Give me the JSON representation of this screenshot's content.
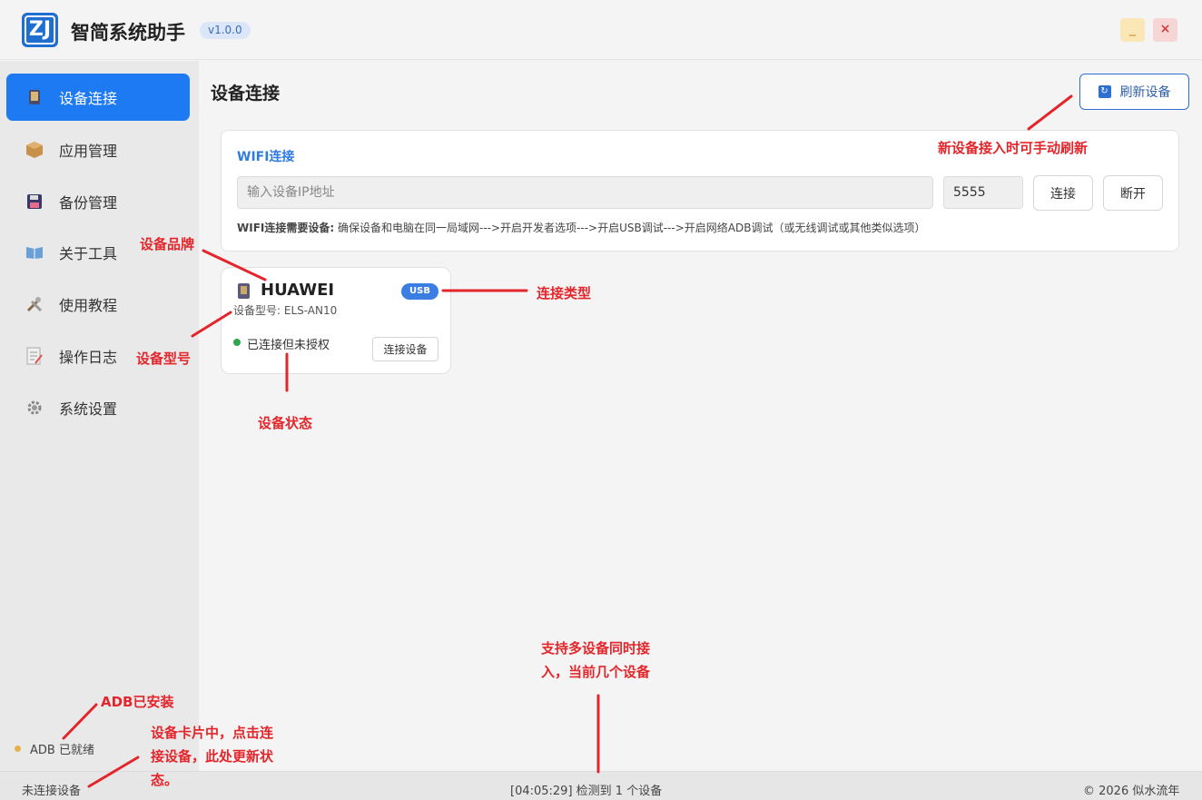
{
  "app": {
    "title": "智简系统助手",
    "version": "v1.0.0",
    "logo_text": "ZJ",
    "minimize": "_",
    "close": "×"
  },
  "sidebar": {
    "items": [
      {
        "label": "设备连接",
        "icon": "tablet-icon",
        "active": true
      },
      {
        "label": "应用管理",
        "icon": "package-icon",
        "active": false
      },
      {
        "label": "备份管理",
        "icon": "floppy-icon",
        "active": false
      },
      {
        "label": "关于工具",
        "icon": "book-icon",
        "active": false
      },
      {
        "label": "使用教程",
        "icon": "tools-icon",
        "active": false
      },
      {
        "label": "操作日志",
        "icon": "memo-icon",
        "active": false
      },
      {
        "label": "系统设置",
        "icon": "gear-icon",
        "active": false
      }
    ],
    "adb_status": "ADB 已就绪"
  },
  "main": {
    "title": "设备连接",
    "refresh_label": "刷新设备",
    "wifi": {
      "title": "WIFI连接",
      "ip_placeholder": "输入设备IP地址",
      "port_value": "5555",
      "connect_label": "连接",
      "disconnect_label": "断开",
      "hint_label": "WIFI连接需要设备:",
      "hint_text": "确保设备和电脑在同一局域网--->开启开发者选项--->开启USB调试--->开启网络ADB调试（或无线调试或其他类似选项）"
    },
    "device": {
      "brand": "HUAWEI",
      "connection_type": "USB",
      "model_label": "设备型号: ELS-AN10",
      "status": "已连接但未授权",
      "connect_label": "连接设备"
    }
  },
  "statusbar": {
    "left": "未连接设备",
    "center": "[04:05:29] 检测到 1 个设备",
    "right": "© 2026 似水流年"
  },
  "annotations": {
    "refresh": "新设备接入时可手动刷新",
    "brand": "设备品牌",
    "conn_type": "连接类型",
    "model": "设备型号",
    "status": "设备状态",
    "multi": "支持多设备同时接入，当前几个设备",
    "adb": "ADB已安装",
    "card": "设备卡片中，点击连接设备，此处更新状态。"
  },
  "colors": {
    "accent": "#1e7af3",
    "annotation": "#e3262b",
    "status_ok": "#2ea84a",
    "adb_dot": "#e8b04c"
  }
}
